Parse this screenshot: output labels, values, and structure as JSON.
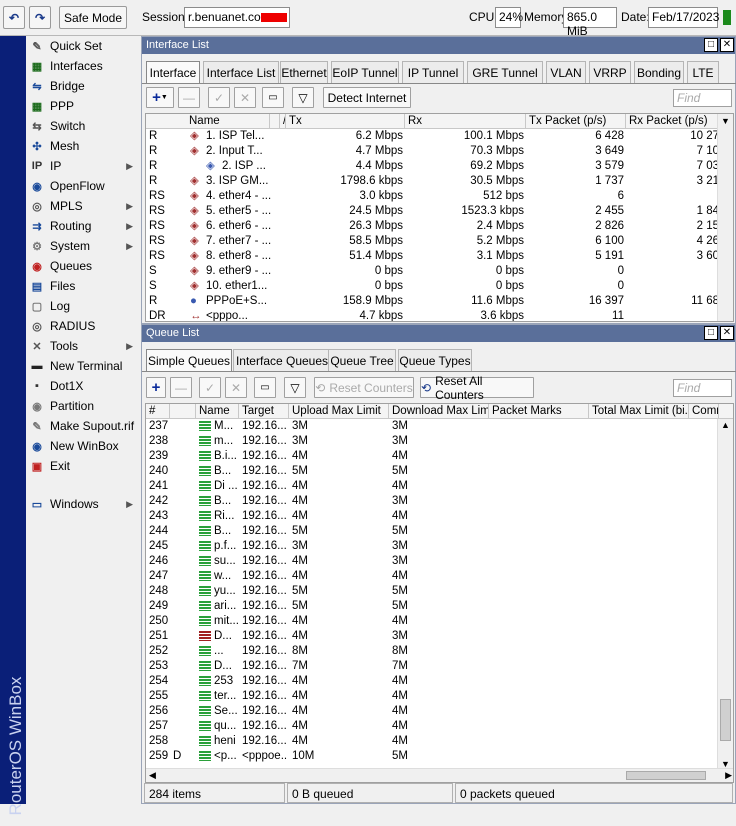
{
  "topbar": {
    "safe_mode": "Safe Mode",
    "session_label": "Session:",
    "session_value": "r.benuanet.com",
    "cpu_label": "CPU:",
    "cpu_value": "24%",
    "memory_label": "Memory:",
    "memory_value": "865.0 MiB",
    "date_label": "Date:",
    "date_value": "Feb/17/2023"
  },
  "brand": "RouterOS WinBox",
  "sidebar": [
    {
      "label": "Quick Set",
      "icon": "quick-set-icon",
      "sub": false
    },
    {
      "label": "Interfaces",
      "icon": "interfaces-icon",
      "sub": false
    },
    {
      "label": "Bridge",
      "icon": "bridge-icon",
      "sub": false
    },
    {
      "label": "PPP",
      "icon": "ppp-icon",
      "sub": false
    },
    {
      "label": "Switch",
      "icon": "switch-icon",
      "sub": false
    },
    {
      "label": "Mesh",
      "icon": "mesh-icon",
      "sub": false
    },
    {
      "label": "IP",
      "icon": "ip-icon",
      "sub": true
    },
    {
      "label": "OpenFlow",
      "icon": "openflow-icon",
      "sub": false
    },
    {
      "label": "MPLS",
      "icon": "mpls-icon",
      "sub": true
    },
    {
      "label": "Routing",
      "icon": "routing-icon",
      "sub": true
    },
    {
      "label": "System",
      "icon": "system-icon",
      "sub": true
    },
    {
      "label": "Queues",
      "icon": "queues-icon",
      "sub": false
    },
    {
      "label": "Files",
      "icon": "files-icon",
      "sub": false
    },
    {
      "label": "Log",
      "icon": "log-icon",
      "sub": false
    },
    {
      "label": "RADIUS",
      "icon": "radius-icon",
      "sub": false
    },
    {
      "label": "Tools",
      "icon": "tools-icon",
      "sub": true
    },
    {
      "label": "New Terminal",
      "icon": "terminal-icon",
      "sub": false
    },
    {
      "label": "Dot1X",
      "icon": "dot1x-icon",
      "sub": false
    },
    {
      "label": "Partition",
      "icon": "partition-icon",
      "sub": false
    },
    {
      "label": "Make Supout.rif",
      "icon": "supout-icon",
      "sub": false
    },
    {
      "label": "New WinBox",
      "icon": "winbox-icon",
      "sub": false
    },
    {
      "label": "Exit",
      "icon": "exit-icon",
      "sub": false
    },
    {
      "label": "Windows",
      "icon": "windows-icon",
      "sub": true
    }
  ],
  "interface_list": {
    "title": "Interface List",
    "tabs": [
      "Interface",
      "Interface List",
      "Ethernet",
      "EoIP Tunnel",
      "IP Tunnel",
      "GRE Tunnel",
      "VLAN",
      "VRRP",
      "Bonding",
      "LTE"
    ],
    "detect_internet": "Detect Internet",
    "find_placeholder": "Find",
    "columns": [
      "Name",
      "",
      "/",
      "Tx",
      "Rx",
      "Tx Packet (p/s)",
      "Rx Packet (p/s)"
    ],
    "rows": [
      {
        "flag": "R",
        "name": "1. ISP Tel...",
        "tx": "6.2 Mbps",
        "rx": "100.1 Mbps",
        "txp": "6 428",
        "rxp": "10 27"
      },
      {
        "flag": "R",
        "name": "2. Input T...",
        "tx": "4.7 Mbps",
        "rx": "70.3 Mbps",
        "txp": "3 649",
        "rxp": "7 10"
      },
      {
        "flag": "R",
        "name": "2. ISP ...",
        "tx": "4.4 Mbps",
        "rx": "69.2 Mbps",
        "txp": "3 579",
        "rxp": "7 03"
      },
      {
        "flag": "R",
        "name": "3. ISP GM...",
        "tx": "1798.6 kbps",
        "rx": "30.5 Mbps",
        "txp": "1 737",
        "rxp": "3 21"
      },
      {
        "flag": "RS",
        "name": "4. ether4 - ...",
        "tx": "3.0 kbps",
        "rx": "512 bps",
        "txp": "6",
        "rxp": ""
      },
      {
        "flag": "RS",
        "name": "5. ether5 - ...",
        "tx": "24.5 Mbps",
        "rx": "1523.3 kbps",
        "txp": "2 455",
        "rxp": "1 84"
      },
      {
        "flag": "RS",
        "name": "6. ether6 - ...",
        "tx": "26.3 Mbps",
        "rx": "2.4 Mbps",
        "txp": "2 826",
        "rxp": "2 15"
      },
      {
        "flag": "RS",
        "name": "7. ether7 - ...",
        "tx": "58.5 Mbps",
        "rx": "5.2 Mbps",
        "txp": "6 100",
        "rxp": "4 26"
      },
      {
        "flag": "RS",
        "name": "8. ether8 - ...",
        "tx": "51.4 Mbps",
        "rx": "3.1 Mbps",
        "txp": "5 191",
        "rxp": "3 60"
      },
      {
        "flag": "S",
        "name": "9. ether9 - ...",
        "tx": "0 bps",
        "rx": "0 bps",
        "txp": "0",
        "rxp": ""
      },
      {
        "flag": "S",
        "name": "10. ether1...",
        "tx": "0 bps",
        "rx": "0 bps",
        "txp": "0",
        "rxp": ""
      },
      {
        "flag": "R",
        "name": "PPPoE+S...",
        "tx": "158.9 Mbps",
        "rx": "11.6 Mbps",
        "txp": "16 397",
        "rxp": "11 68"
      },
      {
        "flag": "DR",
        "name": "<pppo...",
        "tx": "4.7 kbps",
        "rx": "3.6 kbps",
        "txp": "11",
        "rxp": ""
      }
    ]
  },
  "queue_list": {
    "title": "Queue List",
    "tabs": [
      "Simple Queues",
      "Interface Queues",
      "Queue Tree",
      "Queue Types"
    ],
    "reset_counters": "Reset Counters",
    "reset_all_counters": "Reset All Counters",
    "find_placeholder": "Find",
    "columns": [
      "#",
      "",
      "Name",
      "Target",
      "Upload Max Limit",
      "Download Max Limit",
      "Packet Marks",
      "Total Max Limit (bi...",
      "Comm"
    ],
    "rows": [
      {
        "n": "237",
        "f": "",
        "name": "M...",
        "target": "192.16...",
        "up": "3M",
        "down": "3M"
      },
      {
        "n": "238",
        "f": "",
        "name": "m...",
        "target": "192.16...",
        "up": "3M",
        "down": "3M"
      },
      {
        "n": "239",
        "f": "",
        "name": "B.i...",
        "target": "192.16...",
        "up": "4M",
        "down": "4M"
      },
      {
        "n": "240",
        "f": "",
        "name": "B...",
        "target": "192.16...",
        "up": "5M",
        "down": "5M"
      },
      {
        "n": "241",
        "f": "",
        "name": "Di ...",
        "target": "192.16...",
        "up": "4M",
        "down": "4M"
      },
      {
        "n": "242",
        "f": "",
        "name": "B...",
        "target": "192.16...",
        "up": "4M",
        "down": "3M"
      },
      {
        "n": "243",
        "f": "",
        "name": "Ri...",
        "target": "192.16...",
        "up": "4M",
        "down": "4M"
      },
      {
        "n": "244",
        "f": "",
        "name": "B...",
        "target": "192.16...",
        "up": "5M",
        "down": "5M"
      },
      {
        "n": "245",
        "f": "",
        "name": "p.f...",
        "target": "192.16...",
        "up": "3M",
        "down": "3M"
      },
      {
        "n": "246",
        "f": "",
        "name": "su...",
        "target": "192.16...",
        "up": "4M",
        "down": "3M"
      },
      {
        "n": "247",
        "f": "",
        "name": "w...",
        "target": "192.16...",
        "up": "4M",
        "down": "4M"
      },
      {
        "n": "248",
        "f": "",
        "name": "yu...",
        "target": "192.16...",
        "up": "5M",
        "down": "5M"
      },
      {
        "n": "249",
        "f": "",
        "name": "ari...",
        "target": "192.16...",
        "up": "5M",
        "down": "5M"
      },
      {
        "n": "250",
        "f": "",
        "name": "mit...",
        "target": "192.16...",
        "up": "4M",
        "down": "4M"
      },
      {
        "n": "251",
        "f": "",
        "name": "D...",
        "target": "192.16...",
        "up": "4M",
        "down": "3M",
        "red": true
      },
      {
        "n": "252",
        "f": "",
        "name": "...",
        "target": "192.16...",
        "up": "8M",
        "down": "8M"
      },
      {
        "n": "253",
        "f": "",
        "name": "D...",
        "target": "192.16...",
        "up": "7M",
        "down": "7M"
      },
      {
        "n": "254",
        "f": "",
        "name": "253",
        "target": "192.16...",
        "up": "4M",
        "down": "4M"
      },
      {
        "n": "255",
        "f": "",
        "name": "ter...",
        "target": "192.16...",
        "up": "4M",
        "down": "4M"
      },
      {
        "n": "256",
        "f": "",
        "name": "Se...",
        "target": "192.16...",
        "up": "4M",
        "down": "4M"
      },
      {
        "n": "257",
        "f": "",
        "name": "qu...",
        "target": "192.16...",
        "up": "4M",
        "down": "4M"
      },
      {
        "n": "258",
        "f": "",
        "name": "heni",
        "target": "192.16...",
        "up": "4M",
        "down": "4M"
      },
      {
        "n": "259",
        "f": "D",
        "name": "<p...",
        "target": "<pppoe...",
        "up": "10M",
        "down": "5M"
      }
    ],
    "status_items": "284 items",
    "status_bytes": "0 B queued",
    "status_packets": "0 packets queued"
  }
}
